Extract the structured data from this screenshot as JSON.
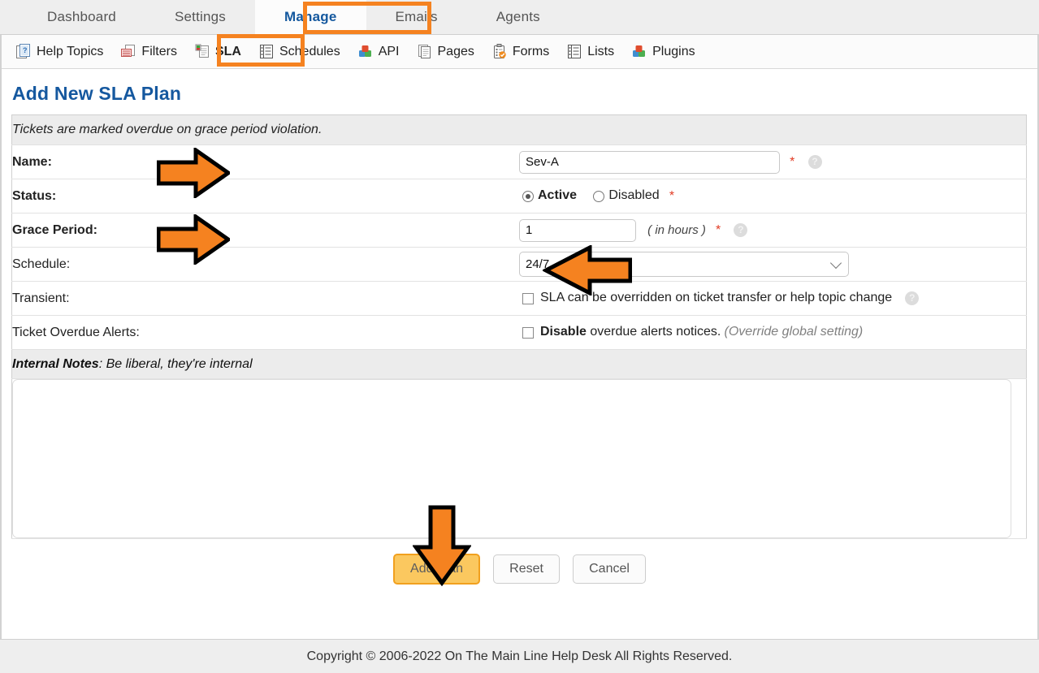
{
  "top_nav": {
    "tabs": [
      {
        "label": "Dashboard",
        "active": false
      },
      {
        "label": "Settings",
        "active": false
      },
      {
        "label": "Manage",
        "active": true
      },
      {
        "label": "Emails",
        "active": false
      },
      {
        "label": "Agents",
        "active": false
      }
    ]
  },
  "sub_nav": {
    "items": [
      {
        "label": "Help Topics",
        "icon": "help-topics-icon",
        "active": false
      },
      {
        "label": "Filters",
        "icon": "filters-icon",
        "active": false
      },
      {
        "label": "SLA",
        "icon": "sla-icon",
        "active": true
      },
      {
        "label": "Schedules",
        "icon": "schedules-icon",
        "active": false
      },
      {
        "label": "API",
        "icon": "api-icon",
        "active": false
      },
      {
        "label": "Pages",
        "icon": "pages-icon",
        "active": false
      },
      {
        "label": "Forms",
        "icon": "forms-icon",
        "active": false
      },
      {
        "label": "Lists",
        "icon": "lists-icon",
        "active": false
      },
      {
        "label": "Plugins",
        "icon": "plugins-icon",
        "active": false
      }
    ]
  },
  "page": {
    "title": "Add New SLA Plan",
    "section_note": "Tickets are marked overdue on grace period violation."
  },
  "form": {
    "name": {
      "label": "Name:",
      "value": "Sev-A",
      "placeholder": "",
      "required_marker": "*",
      "help_icon": "?"
    },
    "status": {
      "label": "Status:",
      "options": [
        {
          "label": "Active",
          "selected": true
        },
        {
          "label": "Disabled",
          "selected": false
        }
      ],
      "required_marker": "*"
    },
    "grace_period": {
      "label": "Grace Period:",
      "value": "1",
      "hint": "( in hours )",
      "required_marker": "*",
      "help_icon": "?"
    },
    "schedule": {
      "label": "Schedule:",
      "value": "24/7",
      "options": [
        "24/7"
      ]
    },
    "transient": {
      "label": "Transient:",
      "checkbox_label": "SLA can be overridden on ticket transfer or help topic change",
      "checked": false,
      "help_icon": "?"
    },
    "overdue_alerts": {
      "label": "Ticket Overdue Alerts:",
      "checkbox_strong": "Disable",
      "checkbox_rest": " overdue alerts notices.",
      "override_note": "(Override global setting)",
      "checked": false
    },
    "internal_notes": {
      "header_strong": "Internal Notes",
      "header_rest": ": Be liberal, they're internal",
      "value": "",
      "placeholder": ""
    }
  },
  "buttons": {
    "submit": "Add Plan",
    "reset": "Reset",
    "cancel": "Cancel"
  },
  "footer": {
    "copyright": "Copyright © 2006-2022 On The Main Line Help Desk All Rights Reserved."
  },
  "annotations": {
    "arrow_color": "#F58220",
    "highlight_color": "#F58220",
    "arrows": [
      "name-field",
      "grace-period-field",
      "schedule-dropdown",
      "add-plan-button"
    ],
    "boxes": [
      "manage-tab",
      "sla-subnav-item"
    ]
  }
}
